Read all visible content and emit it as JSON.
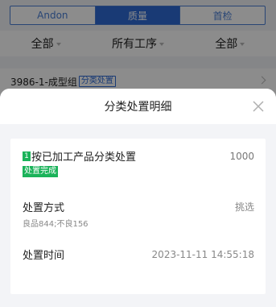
{
  "tabs": [
    {
      "label": "Andon",
      "active": false
    },
    {
      "label": "质量",
      "active": true
    },
    {
      "label": "首检",
      "active": false
    }
  ],
  "filters": [
    {
      "label": "全部"
    },
    {
      "label": "所有工序"
    },
    {
      "label": "全部"
    }
  ],
  "list_row": {
    "title": "3986-1-成型组",
    "tag": "分类处置"
  },
  "sheet": {
    "title": "分类处置明细",
    "item": {
      "index": "1",
      "name": "按已加工产品分类处置",
      "quantity": "1000",
      "status": "处置完成",
      "method_label": "处置方式",
      "method_value": "挑选",
      "method_detail": "良品844;不良156",
      "time_label": "处置时间",
      "time_value": "2023-11-11 14:55:18"
    }
  },
  "colors": {
    "accent": "#2f6bd6",
    "success": "#1bb35a"
  }
}
